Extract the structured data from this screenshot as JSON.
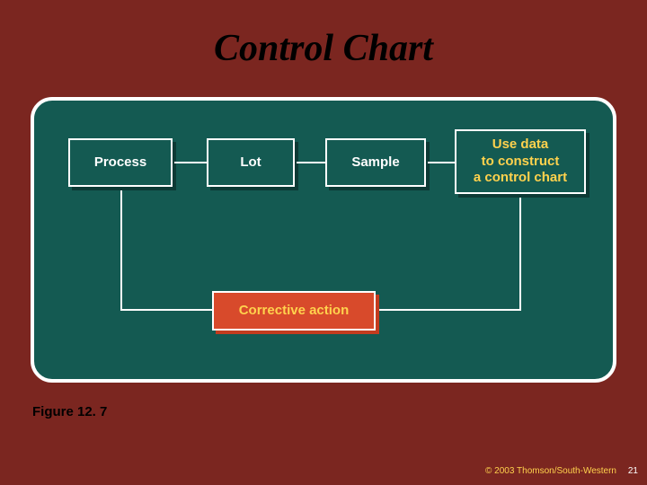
{
  "title": "Control Chart",
  "figure_label": "Figure 12. 7",
  "copyright": "© 2003 Thomson/South-Western",
  "page_number": "21",
  "boxes": {
    "process": "Process",
    "lot": "Lot",
    "sample": "Sample",
    "use_data": "Use data\nto construct\na control chart",
    "corrective": "Corrective action"
  },
  "colors": {
    "background": "#7b2620",
    "panel": "#145a52",
    "accent_box": "#d84a2b",
    "accent_text": "#ffd24d",
    "border": "#ffffff"
  }
}
